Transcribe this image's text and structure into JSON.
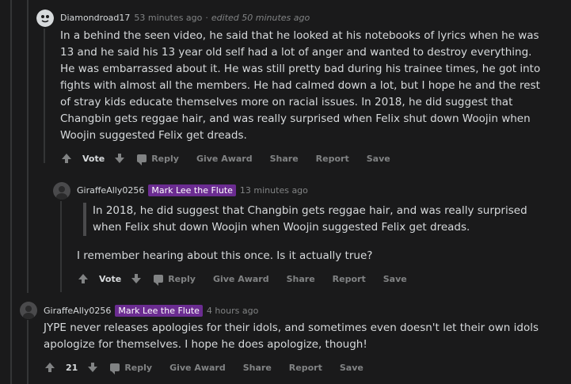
{
  "comments": [
    {
      "username": "Diamondroad17",
      "time": "53 minutes ago",
      "separator": "·",
      "edited": "edited 50 minutes ago",
      "body": "In a behind the seen video, he said that he looked at his notebooks of lyrics when he was 13 and he said his 13 year old self had a lot of anger and wanted to destroy everything. He was embarrassed about it. He was still pretty bad during his trainee times, he got into fights with almost all the members. He had calmed down a lot, but I hope he and the rest of stray kids educate themselves more on racial issues. In 2018, he did suggest that Changbin gets reggae hair, and was really surprised when Felix shut down Woojin when Woojin suggested Felix get dreads.",
      "vote": "Vote",
      "actions": {
        "reply": "Reply",
        "award": "Give Award",
        "share": "Share",
        "report": "Report",
        "save": "Save"
      }
    },
    {
      "username": "GiraffeAlly0256",
      "flair": "Mark Lee the Flute",
      "time": "13 minutes ago",
      "quote": "In 2018, he did suggest that Changbin gets reggae hair, and was really surprised when Felix shut down Woojin when Woojin suggested Felix get dreads.",
      "body": "I remember hearing about this once. Is it actually true?",
      "vote": "Vote",
      "actions": {
        "reply": "Reply",
        "award": "Give Award",
        "share": "Share",
        "report": "Report",
        "save": "Save"
      }
    },
    {
      "username": "GiraffeAlly0256",
      "flair": "Mark Lee the Flute",
      "time": "4 hours ago",
      "body": "JYPE never releases apologies for their idols, and sometimes even doesn't let their own idols apologize for themselves. I hope he does apologize, though!",
      "vote": "21",
      "actions": {
        "reply": "Reply",
        "award": "Give Award",
        "share": "Share",
        "report": "Report",
        "save": "Save"
      }
    }
  ],
  "colors": {
    "background": "#1a1a1b",
    "text": "#d7dadc",
    "muted": "#818384",
    "flair": "#6b2c91"
  },
  "icons": {
    "upvote": "arrow-up-icon",
    "downvote": "arrow-down-icon",
    "reply": "speech-bubble-icon"
  }
}
